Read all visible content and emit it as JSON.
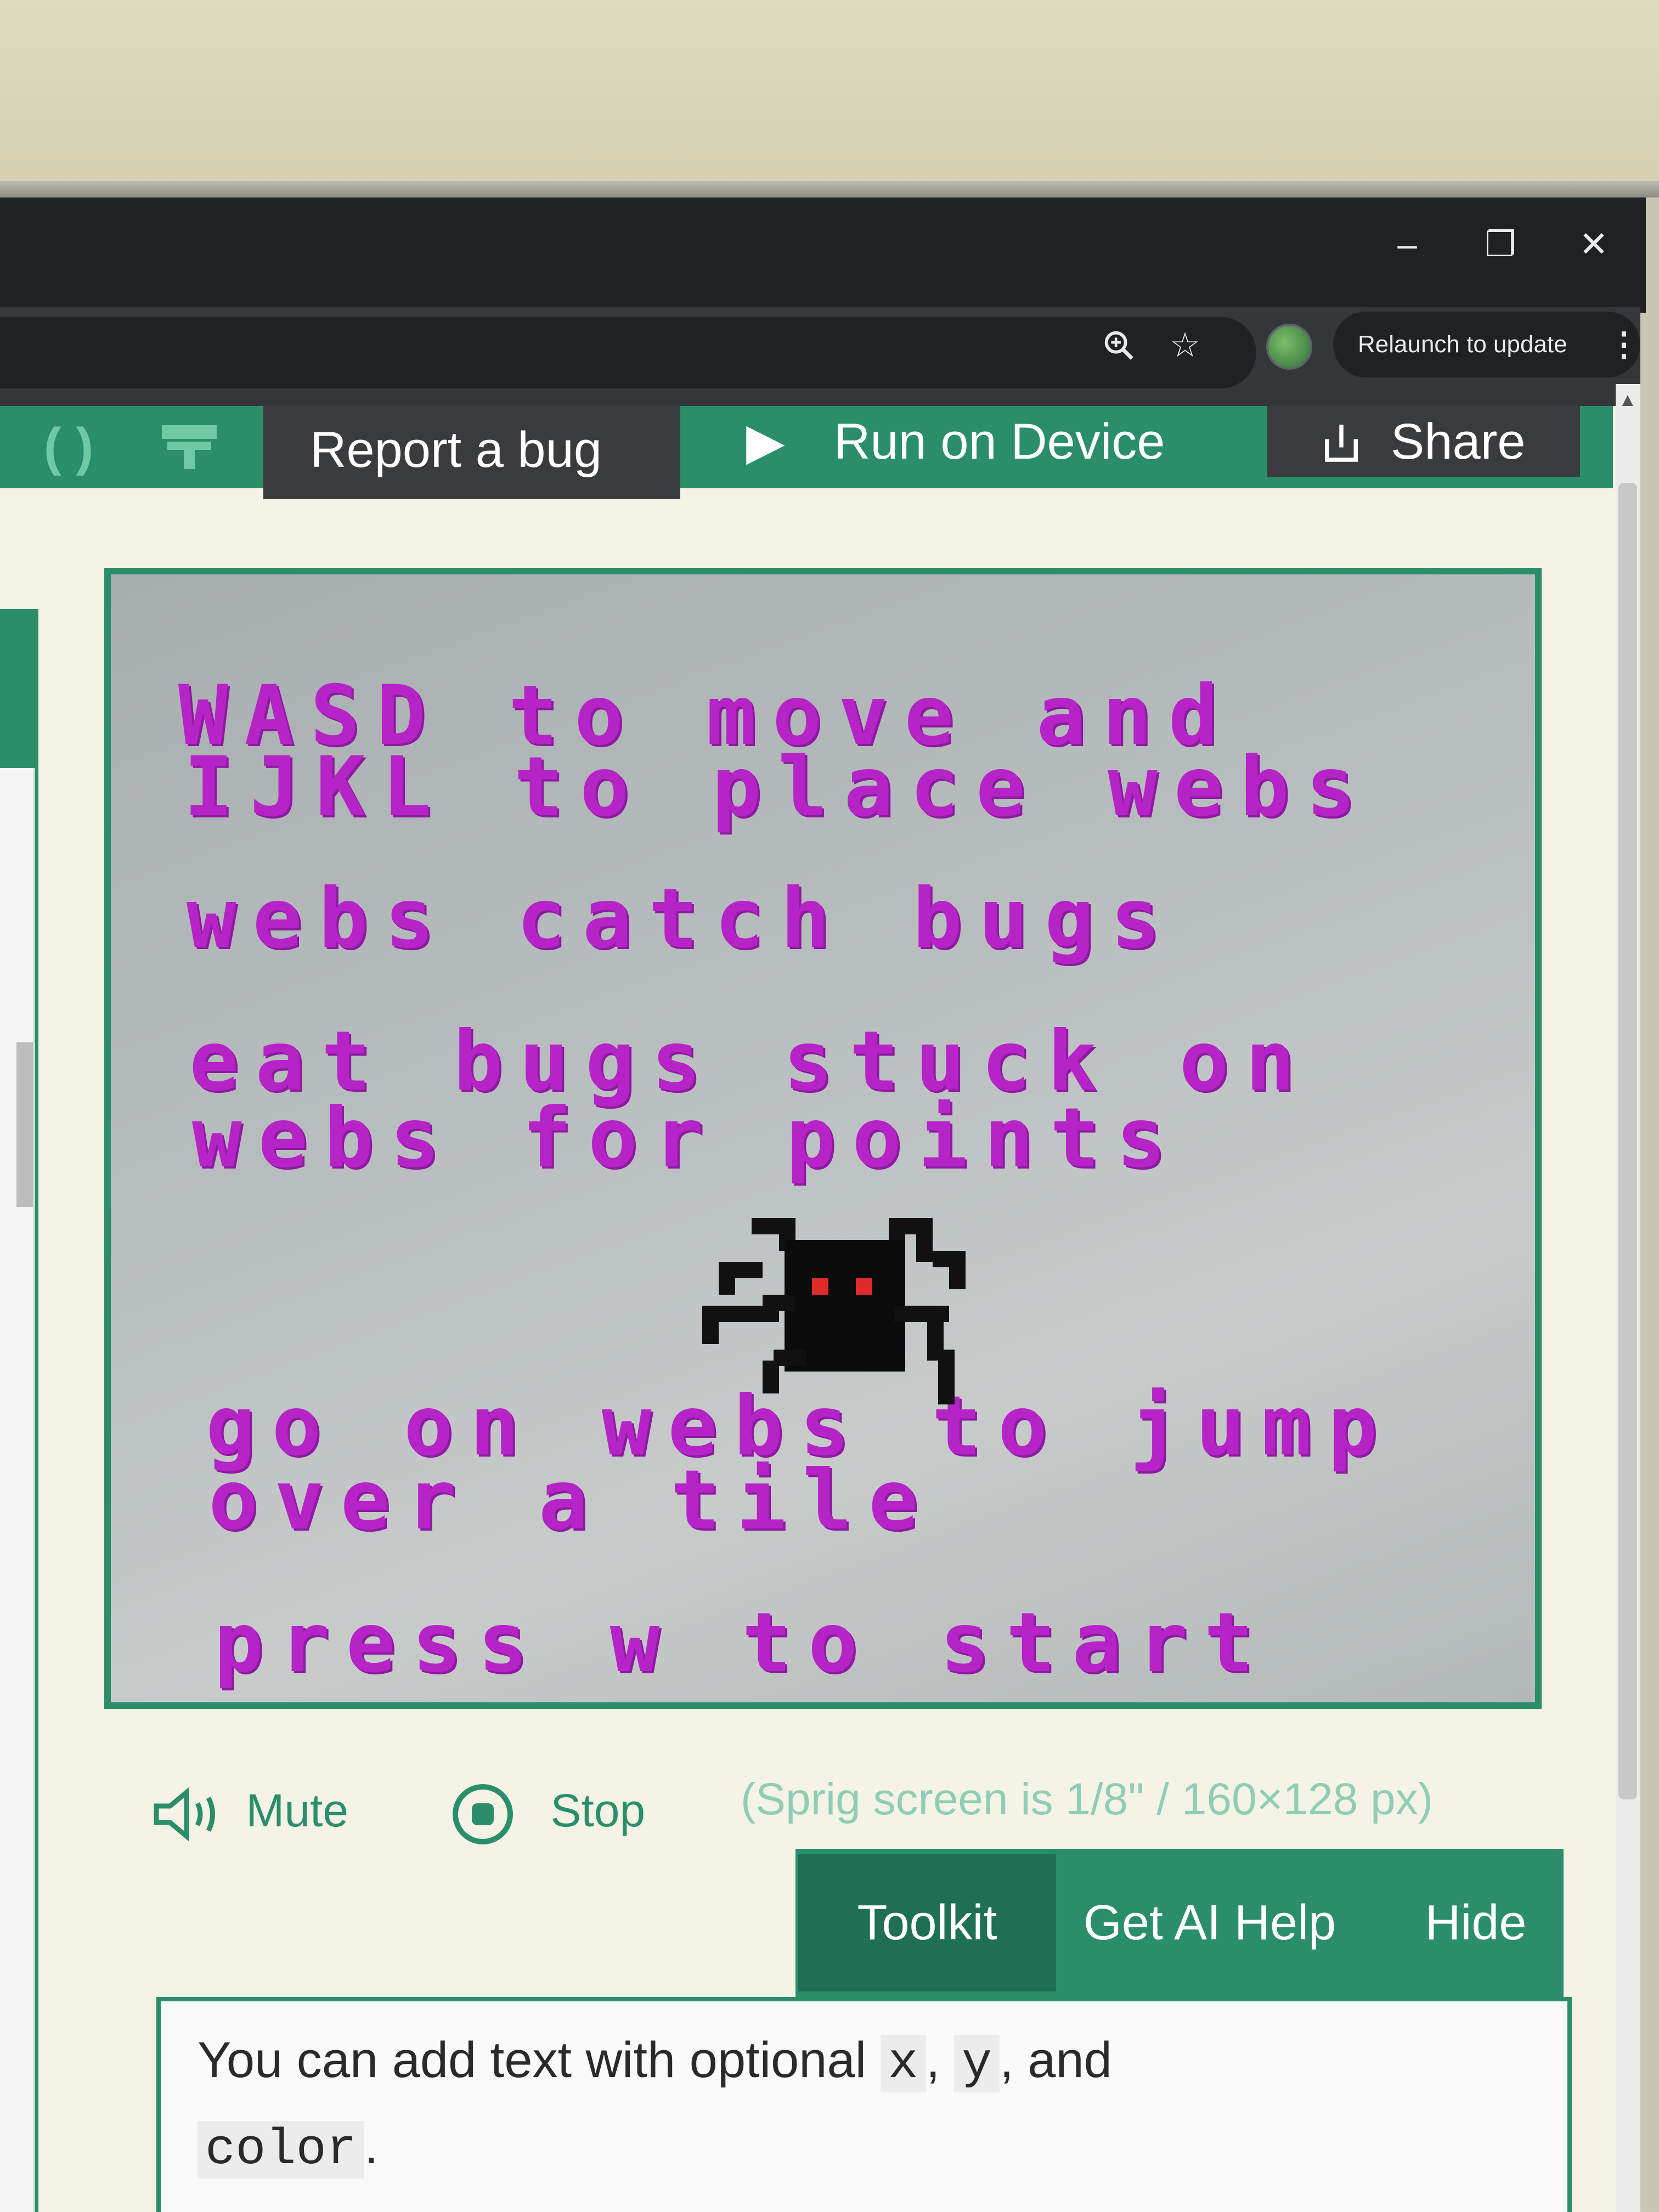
{
  "window": {
    "minimize": "–",
    "restore": "❐",
    "close": "✕"
  },
  "toolbar": {
    "zoom_icon": "zoom-icon",
    "star_icon": "bookmark-star-icon",
    "relaunch_label": "Relaunch to update",
    "menu_icon": "⋮"
  },
  "appbar": {
    "report_bug": "Report a bug",
    "run_on_device": "Run on Device",
    "share": "Share"
  },
  "game": {
    "lines": [
      "WASD to move and",
      "IJKL to place webs",
      "webs catch bugs",
      "eat bugs stuck on",
      "webs for points",
      "go on webs to jump",
      "over a tile",
      "press w to start"
    ],
    "text_color": "#b624c8"
  },
  "controls": {
    "mute": "Mute",
    "stop": "Stop",
    "note": "(Sprig screen is 1/8\" / 160×128 px)"
  },
  "tabs": {
    "toolkit": "Toolkit",
    "ai_help": "Get AI Help",
    "hide": "Hide"
  },
  "doc": {
    "text_before": "You can add text with optional",
    "code_x": "x",
    "sep1": ",",
    "code_y": "y",
    "sep2": ", and",
    "code_color": "color",
    "end": "."
  },
  "colors": {
    "accent": "#2b8e6b",
    "titlebar": "#202124"
  }
}
